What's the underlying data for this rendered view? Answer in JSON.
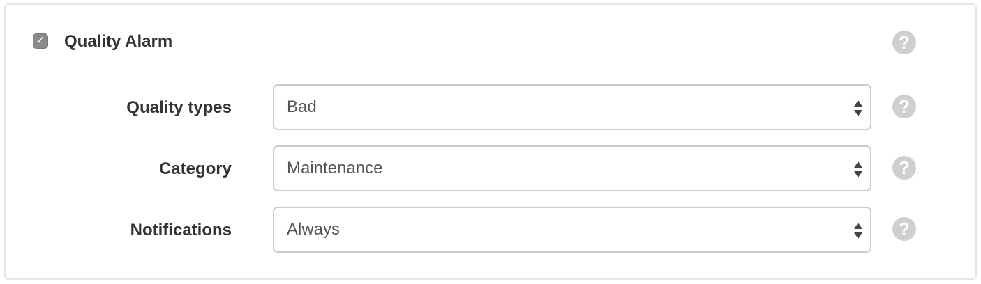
{
  "section": {
    "checked": true,
    "title": "Quality Alarm",
    "help_icon": "question-mark-icon"
  },
  "fields": [
    {
      "label": "Quality types",
      "value": "Bad",
      "help_icon": "question-mark-icon"
    },
    {
      "label": "Category",
      "value": "Maintenance",
      "help_icon": "question-mark-icon"
    },
    {
      "label": "Notifications",
      "value": "Always",
      "help_icon": "question-mark-icon"
    }
  ],
  "icons": {
    "checkmark": "✓",
    "help": "?"
  },
  "colors": {
    "checkbox": "#8a8a8a",
    "help_icon": "#cfcfcf",
    "label_text": "#333333",
    "value_text": "#555555",
    "border": "#cccccc"
  }
}
